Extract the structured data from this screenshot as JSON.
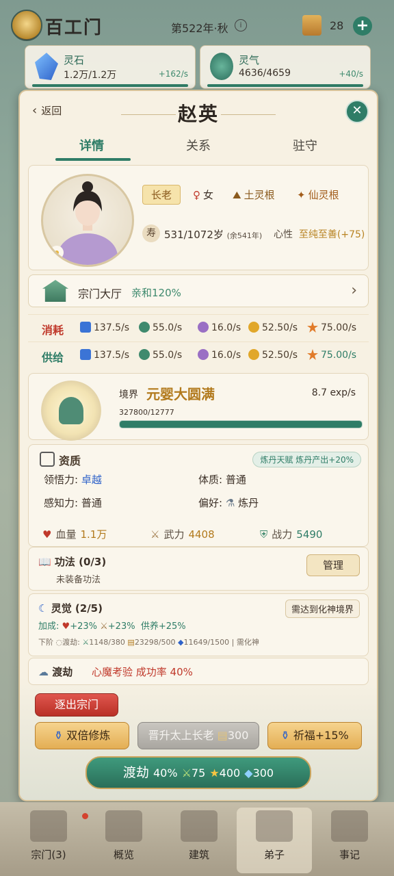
{
  "topbar": {
    "sect_name": "百工门",
    "year": "第522年·秋",
    "coin_count": "28"
  },
  "resources": [
    {
      "name": "灵石",
      "value": "1.2万/1.2万",
      "rate": "+162/s"
    },
    {
      "name": "灵气",
      "value": "4636/4659",
      "rate": "+40/s"
    }
  ],
  "modal": {
    "back_label": "返回",
    "title": "赵英",
    "tabs": [
      "详情",
      "关系",
      "驻守"
    ],
    "active_tab": 0
  },
  "profile": {
    "rank_tag": "长老",
    "gender": "女",
    "root": "土灵根",
    "root2": "仙灵根",
    "life_icon": "寿",
    "lifespan": "531/1072岁",
    "life_remaining": "(余541年)",
    "xinxing_label": "心性",
    "xinxing_value": "至纯至善(+75)"
  },
  "hall": {
    "name": "宗门大厅",
    "bonus": "亲和120%"
  },
  "consume": {
    "label": "消耗",
    "values": [
      "137.5/s",
      "55.0/s",
      "16.0/s",
      "52.50/s",
      "75.00/s"
    ]
  },
  "supply": {
    "label": "供给",
    "values": [
      "137.5/s",
      "55.0/s",
      "16.0/s",
      "52.50/s",
      "75.00/s"
    ]
  },
  "realm": {
    "label": "境界",
    "name": "元婴大圆满",
    "rate": "8.7 exp/s",
    "exp": "327800/12777",
    "progress": 1.0
  },
  "qualities": {
    "title": "资质",
    "badge": "炼丹天赋 炼丹产出+20%",
    "comprehension_label": "领悟力:",
    "comprehension": "卓越",
    "physique_label": "体质:",
    "physique": "普通",
    "perception_label": "感知力:",
    "perception": "普通",
    "preference_label": "偏好:",
    "preference": "炼丹",
    "hp_label": "血量",
    "hp": "1.1万",
    "atk_label": "武力",
    "atk": "4408",
    "power_label": "战力",
    "power": "5490"
  },
  "skills": {
    "title": "功法 (0/3)",
    "empty": "未装备功法",
    "manage": "管理"
  },
  "awakening": {
    "title": "灵觉 (2/5)",
    "need": "需达到化神境界",
    "bonus_label": "加成:",
    "bonus_hp": "+23%",
    "bonus_atk": "+23%",
    "bonus_support": "供养+25%",
    "next_label": "下阶",
    "next_tribulation": "渡劫:",
    "next_a": "1148/380",
    "next_b": "23298/500",
    "next_c": "11649/1500",
    "next_req": "需化神"
  },
  "tribulation": {
    "title": "渡劫",
    "desc": "心魔考验 成功率 40%"
  },
  "actions": {
    "expel": "逐出宗门",
    "double": "双倍修炼",
    "promote": "晋升太上长老",
    "promote_cost": "300",
    "bless": "祈福+15%",
    "tribulate": "渡劫",
    "trib_rate": "40%",
    "cost_a": "75",
    "cost_b": "400",
    "cost_c": "300"
  },
  "nav": [
    {
      "label": "宗门(3)"
    },
    {
      "label": "概览"
    },
    {
      "label": "建筑"
    },
    {
      "label": "弟子"
    },
    {
      "label": "事记"
    }
  ],
  "colors": {
    "accent": "#2f7d67",
    "gold": "#b27a1d",
    "consume": "#c0392b",
    "supply": "#2f7d67"
  }
}
